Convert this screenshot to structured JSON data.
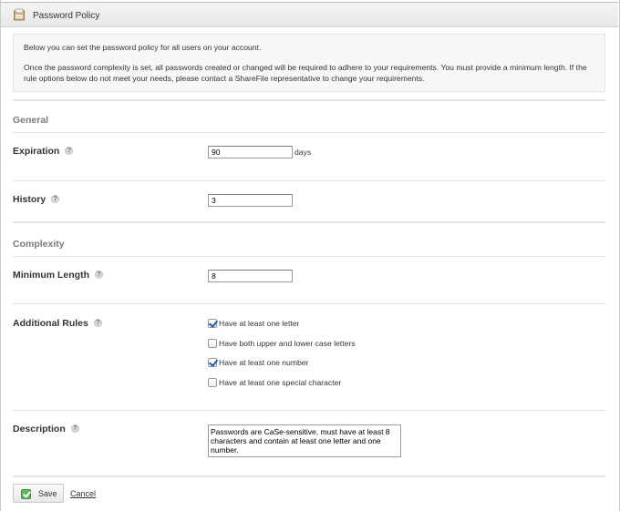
{
  "header": {
    "title": "Password Policy",
    "icon": "clipboard-icon"
  },
  "notice": {
    "line1": "Below you can set the password policy for all users on your account.",
    "line2": "Once the password complexity is set, all passwords created or changed will be required to adhere to your requirements. You must provide a minimum length. If the rule options below do not meet your needs, please contact a ShareFile representative to change your requirements."
  },
  "general": {
    "title": "General",
    "expiration": {
      "label": "Expiration",
      "value": "90",
      "unit": "days"
    },
    "history": {
      "label": "History",
      "value": "3"
    }
  },
  "complexity": {
    "title": "Complexity",
    "min_length": {
      "label": "Minimum Length",
      "value": "8"
    },
    "additional_rules": {
      "label": "Additional Rules",
      "options": [
        {
          "label": "Have at least one letter",
          "checked": true
        },
        {
          "label": "Have both upper and lower case letters",
          "checked": false
        },
        {
          "label": "Have at least one number",
          "checked": true
        },
        {
          "label": "Have at least one special character",
          "checked": false
        }
      ]
    },
    "description": {
      "label": "Description",
      "value": "Passwords are CaSe-sensitive, must have at least 8 characters and contain at least one letter and one number."
    }
  },
  "help_glyph": "?",
  "actions": {
    "save_label": "Save",
    "cancel_label": "Cancel"
  }
}
